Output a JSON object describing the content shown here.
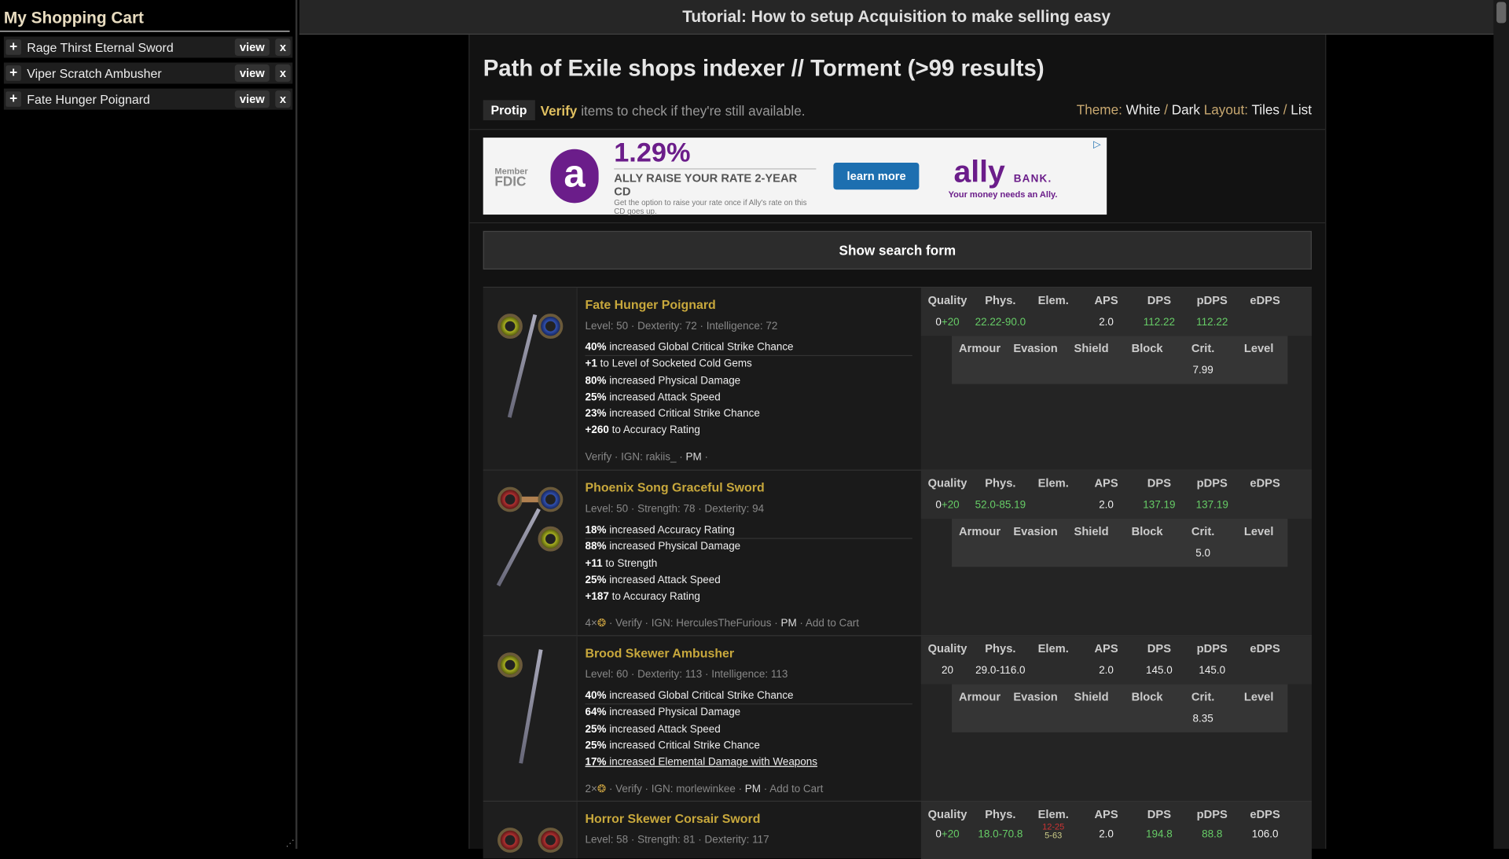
{
  "sidebar": {
    "title": "My Shopping Cart",
    "items": [
      {
        "name": "Rage Thirst Eternal Sword",
        "view": "view",
        "remove": "x"
      },
      {
        "name": "Viper Scratch Ambusher",
        "view": "view",
        "remove": "x"
      },
      {
        "name": "Fate Hunger Poignard",
        "view": "view",
        "remove": "x"
      }
    ]
  },
  "topbar": {
    "title": "Tutorial: How to setup Acquisition to make selling easy"
  },
  "page": {
    "title": "Path of Exile shops indexer // Torment (>99 results)",
    "protip_badge": "Protip",
    "protip_verify": "Verify",
    "protip_text": "items to check if they're still available.",
    "theme_label": "Theme:",
    "theme_white": "White",
    "theme_sep": "/",
    "theme_dark": "Dark",
    "layout_label": "Layout:",
    "layout_tiles": "Tiles",
    "layout_sep": "/",
    "layout_list": "List"
  },
  "ad": {
    "fdic_member": "Member",
    "fdic": "FDIC",
    "rate": "1.29%",
    "rate_headline": "ALLY RAISE YOUR RATE 2-YEAR CD",
    "rate_small": "Get the option to raise your rate once if Ally's rate on this CD goes up.",
    "button": "learn more",
    "brand": "ally",
    "brand_bank": "BANK.",
    "tagline": "Your money needs an Ally."
  },
  "search_toggle": "Show search form",
  "stat_headers": {
    "quality": "Quality",
    "phys": "Phys.",
    "elem": "Elem.",
    "aps": "APS",
    "dps": "DPS",
    "pdps": "pDPS",
    "edps": "eDPS",
    "armour": "Armour",
    "evasion": "Evasion",
    "shield": "Shield",
    "block": "Block",
    "crit": "Crit.",
    "level": "Level"
  },
  "items": [
    {
      "name": "Fate Hunger Poignard",
      "req": "Level: 50 · Dexterity: 72 · Intelligence: 72",
      "mods": [
        [
          "40%",
          "increased Global Critical Strike Chance"
        ],
        [
          "+1",
          "to Level of Socketed Cold Gems"
        ],
        [
          "80%",
          "increased Physical Damage"
        ],
        [
          "25%",
          "increased Attack Speed"
        ],
        [
          "23%",
          "increased Critical Strike Chance"
        ],
        [
          "+260",
          "to Accuracy Rating"
        ]
      ],
      "foot_pre": "Verify · IGN: rakiis_ ·",
      "foot_pm": "PM",
      "foot_post": "·",
      "quality": "0",
      "quality_bonus": "+20",
      "phys": "22.22-90.0",
      "elem": "",
      "aps": "2.0",
      "dps": "112.22",
      "pdps": "112.22",
      "edps": "",
      "crit": "7.99"
    },
    {
      "name": "Phoenix Song Graceful Sword",
      "req": "Level: 50 · Strength: 78 · Dexterity: 94",
      "mods": [
        [
          "18%",
          "increased Accuracy Rating"
        ],
        [
          "88%",
          "increased Physical Damage"
        ],
        [
          "+11",
          "to Strength"
        ],
        [
          "25%",
          "increased Attack Speed"
        ],
        [
          "+187",
          "to Accuracy Rating"
        ]
      ],
      "foot_pre": "4×",
      "foot_mid": "· Verify · IGN: HerculesTheFurious ·",
      "foot_pm": "PM",
      "foot_post": "· Add to Cart",
      "quality": "0",
      "quality_bonus": "+20",
      "phys": "52.0-85.19",
      "elem": "",
      "aps": "2.0",
      "dps": "137.19",
      "pdps": "137.19",
      "edps": "",
      "crit": "5.0"
    },
    {
      "name": "Brood Skewer Ambusher",
      "req": "Level: 60 · Dexterity: 113 · Intelligence: 113",
      "mods": [
        [
          "40%",
          "increased Global Critical Strike Chance"
        ],
        [
          "64%",
          "increased Physical Damage"
        ],
        [
          "25%",
          "increased Attack Speed"
        ],
        [
          "25%",
          "increased Critical Strike Chance"
        ],
        [
          "17%",
          "increased Elemental Damage with Weapons"
        ]
      ],
      "foot_pre": "2×",
      "foot_mid": "· Verify · IGN: morlewinkee ·",
      "foot_pm": "PM",
      "foot_post": "· Add to Cart",
      "quality": "20",
      "quality_bonus": "",
      "phys": "29.0-116.0",
      "elem": "",
      "aps": "2.0",
      "dps": "145.0",
      "pdps": "145.0",
      "edps": "",
      "crit": "8.35"
    },
    {
      "name": "Horror Skewer Corsair Sword",
      "req": "Level: 58 · Strength: 81 · Dexterity: 117",
      "quality": "0",
      "quality_bonus": "+20",
      "phys": "18.0-70.8",
      "elem_red": "12-25",
      "elem_yellow": "5-63",
      "aps": "2.0",
      "dps": "194.8",
      "pdps": "88.8",
      "edps": "106.0"
    }
  ],
  "colors": {
    "item_name": "#c8a83c",
    "bonus_green": "#66cc66",
    "fire_red": "#cc3333",
    "brand_purple": "#6b1d8a"
  }
}
